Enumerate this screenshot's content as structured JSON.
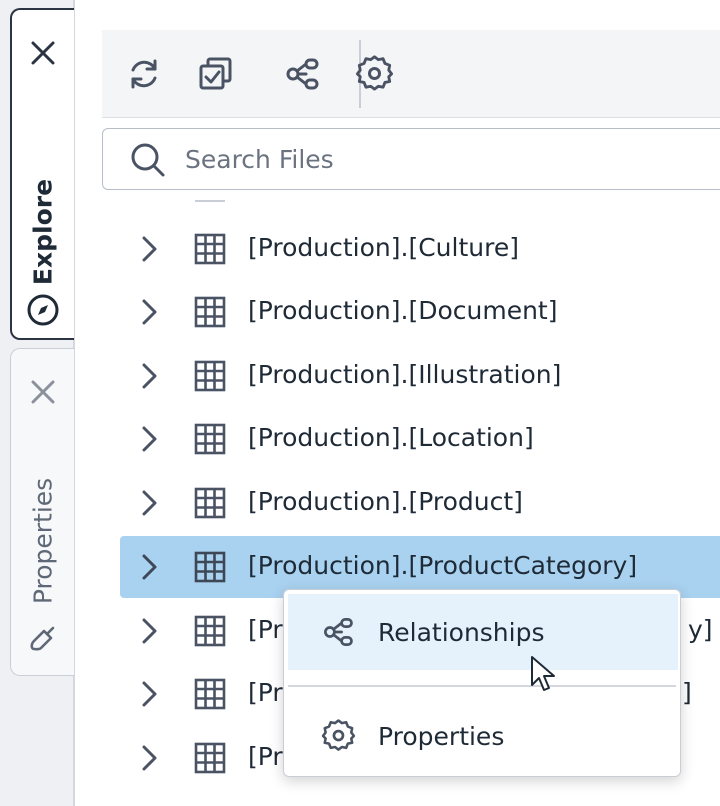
{
  "tabs": {
    "explore": {
      "label": "Explore",
      "icon": "compass-icon",
      "active": true
    },
    "properties": {
      "label": "Properties",
      "icon": "brush-icon",
      "active": false
    }
  },
  "toolbar": {
    "buttons": [
      {
        "name": "refresh",
        "icon": "refresh-icon"
      },
      {
        "name": "select-all",
        "icon": "checkbox-stack-icon"
      },
      {
        "name": "relationships",
        "icon": "relationships-icon"
      },
      {
        "name": "settings",
        "icon": "gear-icon"
      }
    ]
  },
  "search": {
    "placeholder": "Search Files",
    "value": ""
  },
  "tree": {
    "rows": [
      {
        "label": "[Production].[Culture]"
      },
      {
        "label": "[Production].[Document]"
      },
      {
        "label": "[Production].[Illustration]"
      },
      {
        "label": "[Production].[Location]"
      },
      {
        "label": "[Production].[Product]"
      },
      {
        "label": "[Production].[ProductCategory]",
        "selected": true
      },
      {
        "label": "[Pr",
        "tail": "y]"
      },
      {
        "label": "[Pr",
        "tail": "]"
      },
      {
        "label": "[Pr",
        "tail": ""
      }
    ]
  },
  "context_menu": {
    "items": [
      {
        "label": "Relationships",
        "icon": "relationships-icon",
        "hover": true
      },
      {
        "label": "Properties",
        "icon": "gear-icon"
      }
    ]
  },
  "colors": {
    "selected_row": "#a9d2f0",
    "menu_hover": "#e5f1fb",
    "icon": "#4a5363"
  }
}
